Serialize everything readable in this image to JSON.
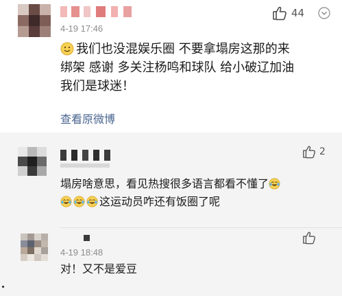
{
  "main_comment": {
    "author": "",
    "time": "4-19 17:46",
    "likes": "44",
    "content_lines": [
      "我们也没混娱乐圈 不要拿塌房这那的来",
      "绑架 感谢 多关注杨鸣和球队 给小破辽加油",
      "我们是球迷！"
    ],
    "leading_emoji": "smile-emoji",
    "view_original": "查看原微博"
  },
  "replies": [
    {
      "author": "",
      "time": "",
      "likes": "2",
      "lines": [
        "塌房啥意思，看见热搜很多语言都看不懂了",
        "这运动员咋还有饭圈了呢"
      ],
      "emoji": "laugh-cry-emoji"
    },
    {
      "author": "",
      "time": "4-19 18:48",
      "likes": "",
      "lines": [
        "对！又不是爱豆"
      ]
    }
  ],
  "icons": {
    "like": "thumbs-up-icon",
    "more": "chevron-down-icon"
  },
  "colors": {
    "link": "#4a6590",
    "reply_bg": "#f4f4f4",
    "time": "#8c8c8c"
  }
}
